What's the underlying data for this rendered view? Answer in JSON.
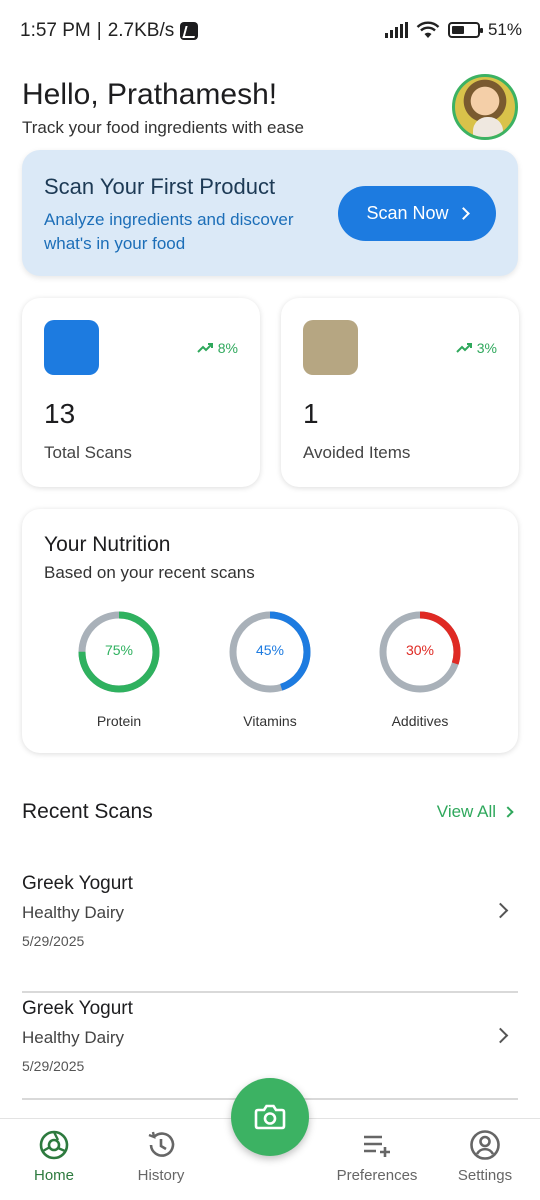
{
  "status_bar": {
    "time": "1:57 PM",
    "net_speed": "2.7KB/s",
    "battery": "51%"
  },
  "header": {
    "greeting": "Hello, Prathamesh!",
    "subtitle": "Track your food ingredients with ease"
  },
  "scan_banner": {
    "title": "Scan Your First Product",
    "description": "Analyze ingredients and discover what's in your food",
    "button_label": "Scan Now"
  },
  "stats": [
    {
      "value": "13",
      "label": "Total Scans",
      "trend": "8%",
      "swatch_color": "#1d7be0"
    },
    {
      "value": "1",
      "label": "Avoided Items",
      "trend": "3%",
      "swatch_color": "#b6a682"
    }
  ],
  "nutrition": {
    "title": "Your Nutrition",
    "subtitle": "Based on your recent scans",
    "metrics": [
      {
        "label": "Protein",
        "percent": 75,
        "text": "75%",
        "color": "#2fb15f"
      },
      {
        "label": "Vitamins",
        "percent": 45,
        "text": "45%",
        "color": "#1d7be0"
      },
      {
        "label": "Additives",
        "percent": 30,
        "text": "30%",
        "color": "#df2a24"
      }
    ]
  },
  "recent": {
    "title": "Recent Scans",
    "view_all": "View All",
    "items": [
      {
        "name": "Greek Yogurt",
        "category": "Healthy Dairy",
        "date": "5/29/2025"
      },
      {
        "name": "Greek Yogurt",
        "category": "Healthy Dairy",
        "date": "5/29/2025"
      }
    ]
  },
  "nav": [
    {
      "label": "Home",
      "icon": "home-icon",
      "active": true
    },
    {
      "label": "History",
      "icon": "history-icon",
      "active": false
    },
    {
      "label": "Preferences",
      "icon": "preferences-icon",
      "active": false
    },
    {
      "label": "Settings",
      "icon": "settings-icon",
      "active": false
    }
  ],
  "colors": {
    "accent_green": "#3cb263",
    "accent_blue": "#1d7be0",
    "banner_bg": "#dbe9f7"
  }
}
